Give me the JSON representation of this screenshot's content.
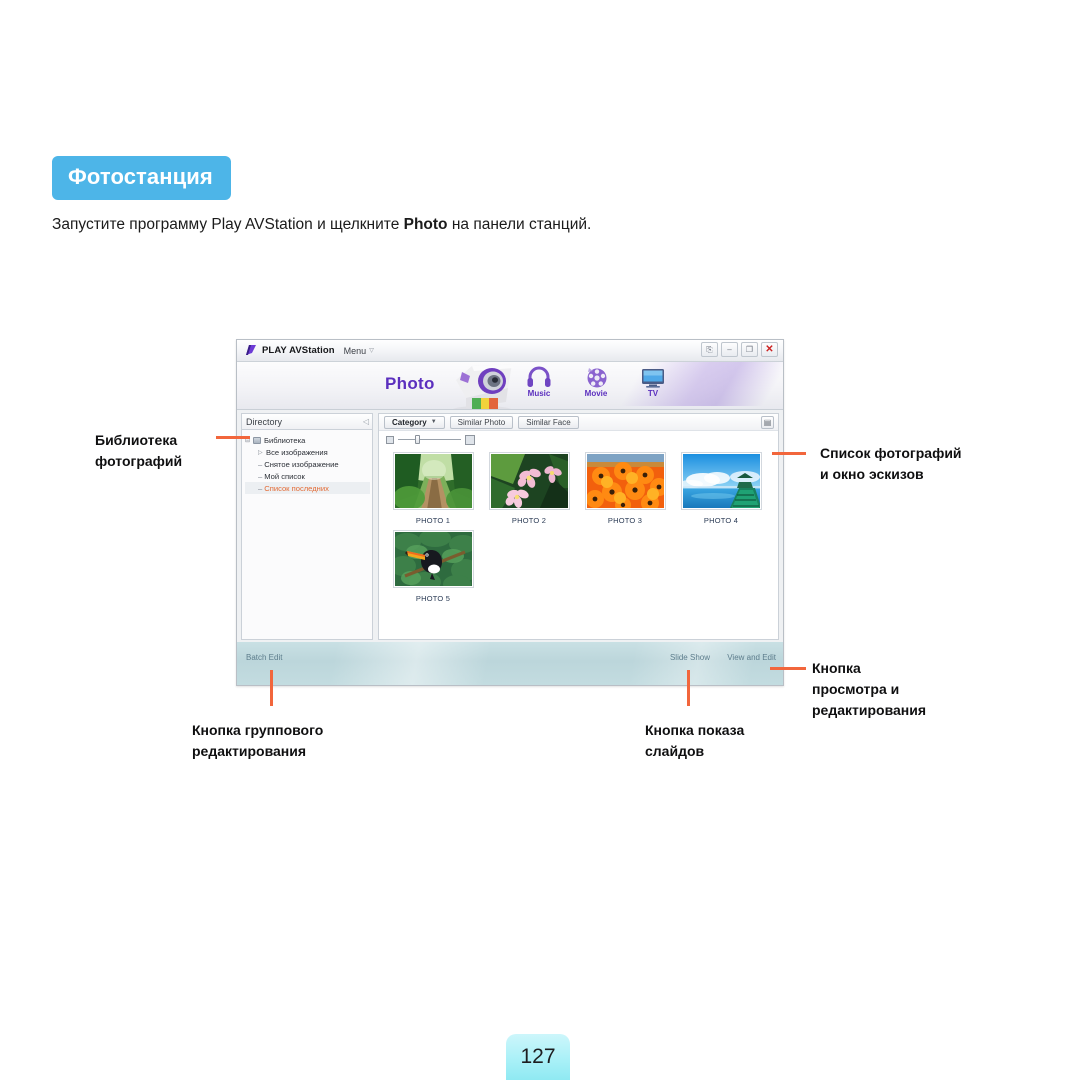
{
  "document": {
    "heading": "Фотостанция",
    "intro_prefix": "Запустите программу Play AVStation и щелкните ",
    "intro_bold": "Photo",
    "intro_suffix": " на панели станций.",
    "page_number": "127"
  },
  "app": {
    "title": "PLAY AVStation",
    "menu_label": "Menu",
    "menu_caret": "▽",
    "window_controls": {
      "rollup": "⎘",
      "minimize": "‒",
      "maximize": "❐",
      "close": "✕"
    },
    "stations": {
      "active_label": "Photo",
      "items": [
        {
          "label": "Music",
          "icon": "headphones-icon"
        },
        {
          "label": "Movie",
          "icon": "film-reel-icon"
        },
        {
          "label": "TV",
          "icon": "television-icon"
        }
      ]
    },
    "sidebar": {
      "header": "Directory",
      "collapse_icon": "◁",
      "tree": [
        {
          "label": "Библиотека",
          "level": "root",
          "toggle": "⊟",
          "selected": false
        },
        {
          "label": "Все изображения",
          "level": "child",
          "toggle": "▷",
          "selected": false
        },
        {
          "label": "Снятое изображение",
          "level": "child",
          "toggle": "–",
          "selected": false
        },
        {
          "label": "Мой список",
          "level": "child",
          "toggle": "–",
          "selected": false
        },
        {
          "label": "Список последних",
          "level": "child",
          "toggle": "–",
          "selected": true
        }
      ]
    },
    "toolbar": {
      "category_label": "Category",
      "category_caret": "▼",
      "similar_photo_label": "Similar Photo",
      "similar_face_label": "Similar Face",
      "list_view_icon": "list-view-icon"
    },
    "thumbnail_slider": {
      "small_icon": "small-thumbnail-icon",
      "large_icon": "large-thumbnail-icon"
    },
    "photos": [
      {
        "caption": "PHOTO 1",
        "subject": "forest-path"
      },
      {
        "caption": "PHOTO 2",
        "subject": "pink-flowers"
      },
      {
        "caption": "PHOTO 3",
        "subject": "orange-flowers"
      },
      {
        "caption": "PHOTO 4",
        "subject": "tropical-pier"
      },
      {
        "caption": "PHOTO 5",
        "subject": "toucan-bird"
      }
    ],
    "status_bar": {
      "batch_edit_label": "Batch Edit",
      "slide_show_label": "Slide Show",
      "view_and_edit_label": "View and Edit"
    }
  },
  "annotations": {
    "library": {
      "line1": "Библиотека",
      "line2": "фотографий"
    },
    "photo_list": {
      "line1": "Список фотографий",
      "line2": "и окно эскизов"
    },
    "batch_edit": {
      "line1": "Кнопка группового",
      "line2": "редактирования"
    },
    "slide_show": {
      "line1": "Кнопка показа",
      "line2": "слайдов"
    },
    "view_edit": {
      "line1": "Кнопка",
      "line2": "просмотра и",
      "line3": "редактирования"
    }
  },
  "colors": {
    "heading_badge": "#4db5e8",
    "leader_line": "#f2663c",
    "station_active": "#5b2fbe",
    "tree_selected": "#e36a34",
    "page_badge": "#a7f0f7"
  }
}
